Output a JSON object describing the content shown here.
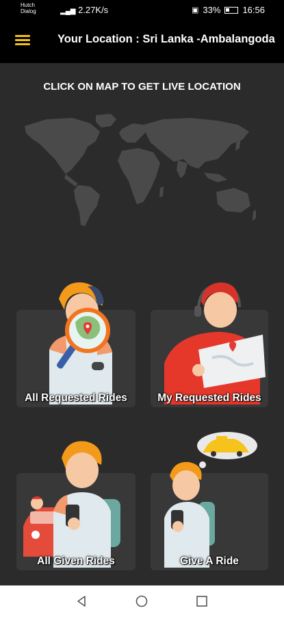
{
  "status_bar": {
    "carrier_1": "Hutch",
    "carrier_2": "Dialog",
    "signal_1": "4G",
    "speed": "2.27K/s",
    "battery": "33%",
    "time": "16:56"
  },
  "app_bar": {
    "menu_icon": "menu-icon",
    "title": "Your Location : Sri Lanka -Ambalangoda"
  },
  "map": {
    "caption": "CLICK ON MAP TO GET LIVE LOCATION"
  },
  "cards": [
    {
      "label": "All  Requested Rides",
      "icon": "magnifier-map-illustration"
    },
    {
      "label": "My Requested Rides",
      "icon": "person-reading-map-illustration"
    },
    {
      "label": "All Given Rides",
      "icon": "person-with-car-illustration"
    },
    {
      "label": "Give A Ride",
      "icon": "person-thinking-taxi-illustration"
    }
  ],
  "nav_bar": {
    "back": "back-icon",
    "home": "home-icon",
    "recents": "recents-icon"
  },
  "colors": {
    "background": "#2b2b2b",
    "card": "#383838",
    "accent": "#f2c313",
    "app_bar": "#000000"
  }
}
